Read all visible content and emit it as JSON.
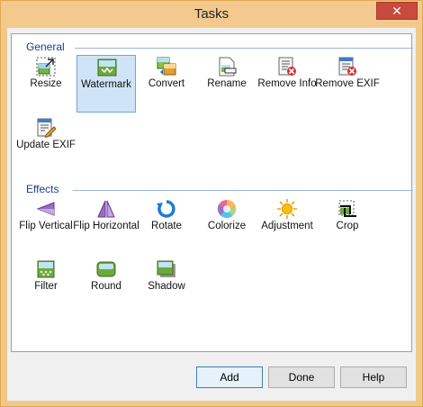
{
  "window": {
    "title": "Tasks",
    "close_glyph": "✕"
  },
  "groups": {
    "general": {
      "label": "General",
      "items": [
        {
          "label": "Resize",
          "icon": "resize-icon"
        },
        {
          "label": "Watermark",
          "icon": "watermark-icon",
          "selected": true
        },
        {
          "label": "Convert",
          "icon": "convert-icon"
        },
        {
          "label": "Rename",
          "icon": "rename-icon"
        },
        {
          "label": "Remove Info",
          "icon": "remove-info-icon"
        },
        {
          "label": "Remove EXIF",
          "icon": "remove-exif-icon"
        },
        {
          "label": "Update EXIF",
          "icon": "update-exif-icon"
        }
      ]
    },
    "effects": {
      "label": "Effects",
      "items": [
        {
          "label": "Flip Vertical",
          "icon": "flip-vertical-icon"
        },
        {
          "label": "Flip Horizontal",
          "icon": "flip-horizontal-icon"
        },
        {
          "label": "Rotate",
          "icon": "rotate-icon"
        },
        {
          "label": "Colorize",
          "icon": "colorize-icon"
        },
        {
          "label": "Adjustment",
          "icon": "adjustment-icon"
        },
        {
          "label": "Crop",
          "icon": "crop-icon"
        },
        {
          "label": "Filter",
          "icon": "filter-icon"
        },
        {
          "label": "Round",
          "icon": "round-icon"
        },
        {
          "label": "Shadow",
          "icon": "shadow-icon"
        }
      ]
    }
  },
  "buttons": {
    "add": "Add",
    "done": "Done",
    "help": "Help"
  },
  "colors": {
    "titlebar": "#f4c98e",
    "close": "#c74a3d",
    "selection": "#cfe4f7",
    "header_text": "#1a3c8c"
  }
}
